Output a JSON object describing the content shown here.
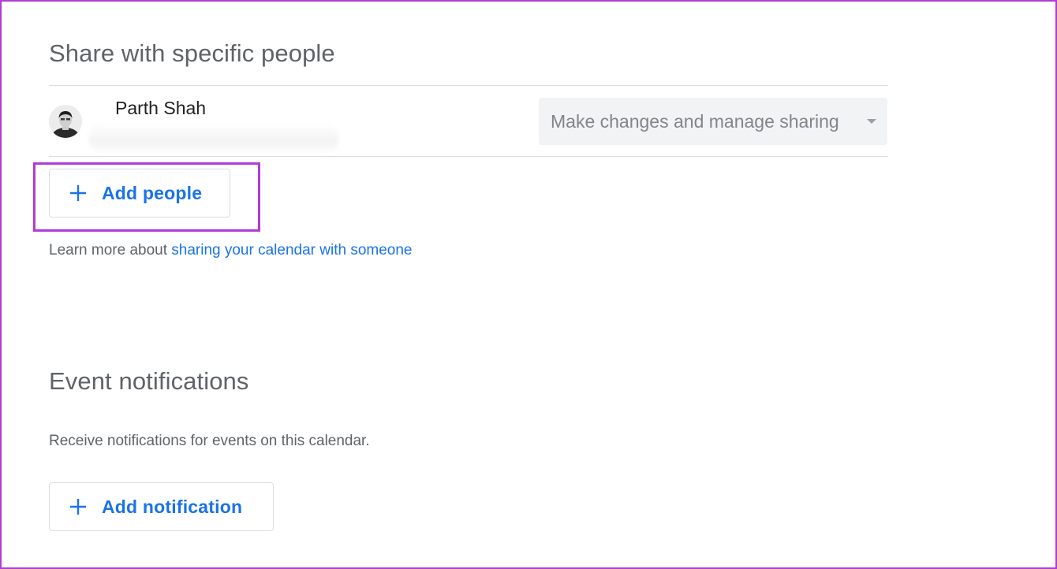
{
  "share_section": {
    "title": "Share with specific people",
    "person": {
      "name": "Parth Shah",
      "permission": "Make changes and manage sharing"
    },
    "add_people_label": "Add people",
    "learn_more_prefix": "Learn more about ",
    "learn_more_link": "sharing your calendar with someone"
  },
  "notifications_section": {
    "title": "Event notifications",
    "description": "Receive notifications for events on this calendar.",
    "add_notification_label": "Add notification"
  },
  "colors": {
    "accent": "#1a73e8",
    "highlight": "#b23ad6"
  }
}
